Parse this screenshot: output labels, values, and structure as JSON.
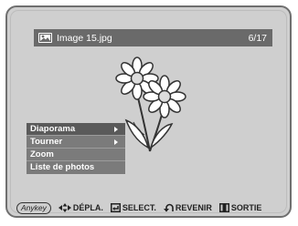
{
  "title_bar": {
    "file_name": "Image 15.jpg",
    "counter": "6/17"
  },
  "menu": {
    "items": [
      {
        "label": "Diaporama",
        "has_submenu": true,
        "selected": true
      },
      {
        "label": "Tourner",
        "has_submenu": true,
        "selected": false
      },
      {
        "label": "Zoom",
        "has_submenu": false,
        "selected": false
      },
      {
        "label": "Liste de photos",
        "has_submenu": false,
        "selected": false
      }
    ]
  },
  "footer": {
    "anykey_label": "Anykey",
    "move_label": "DÉPLA.",
    "select_label": "SELECT.",
    "return_label": "REVENIR",
    "exit_label": "SORTIE"
  },
  "colors": {
    "screen_bg": "#cfcfcf",
    "bar_bg": "#6a6a6a",
    "menu_bg": "#7b7b7b",
    "menu_selected": "#5a5a5a"
  }
}
